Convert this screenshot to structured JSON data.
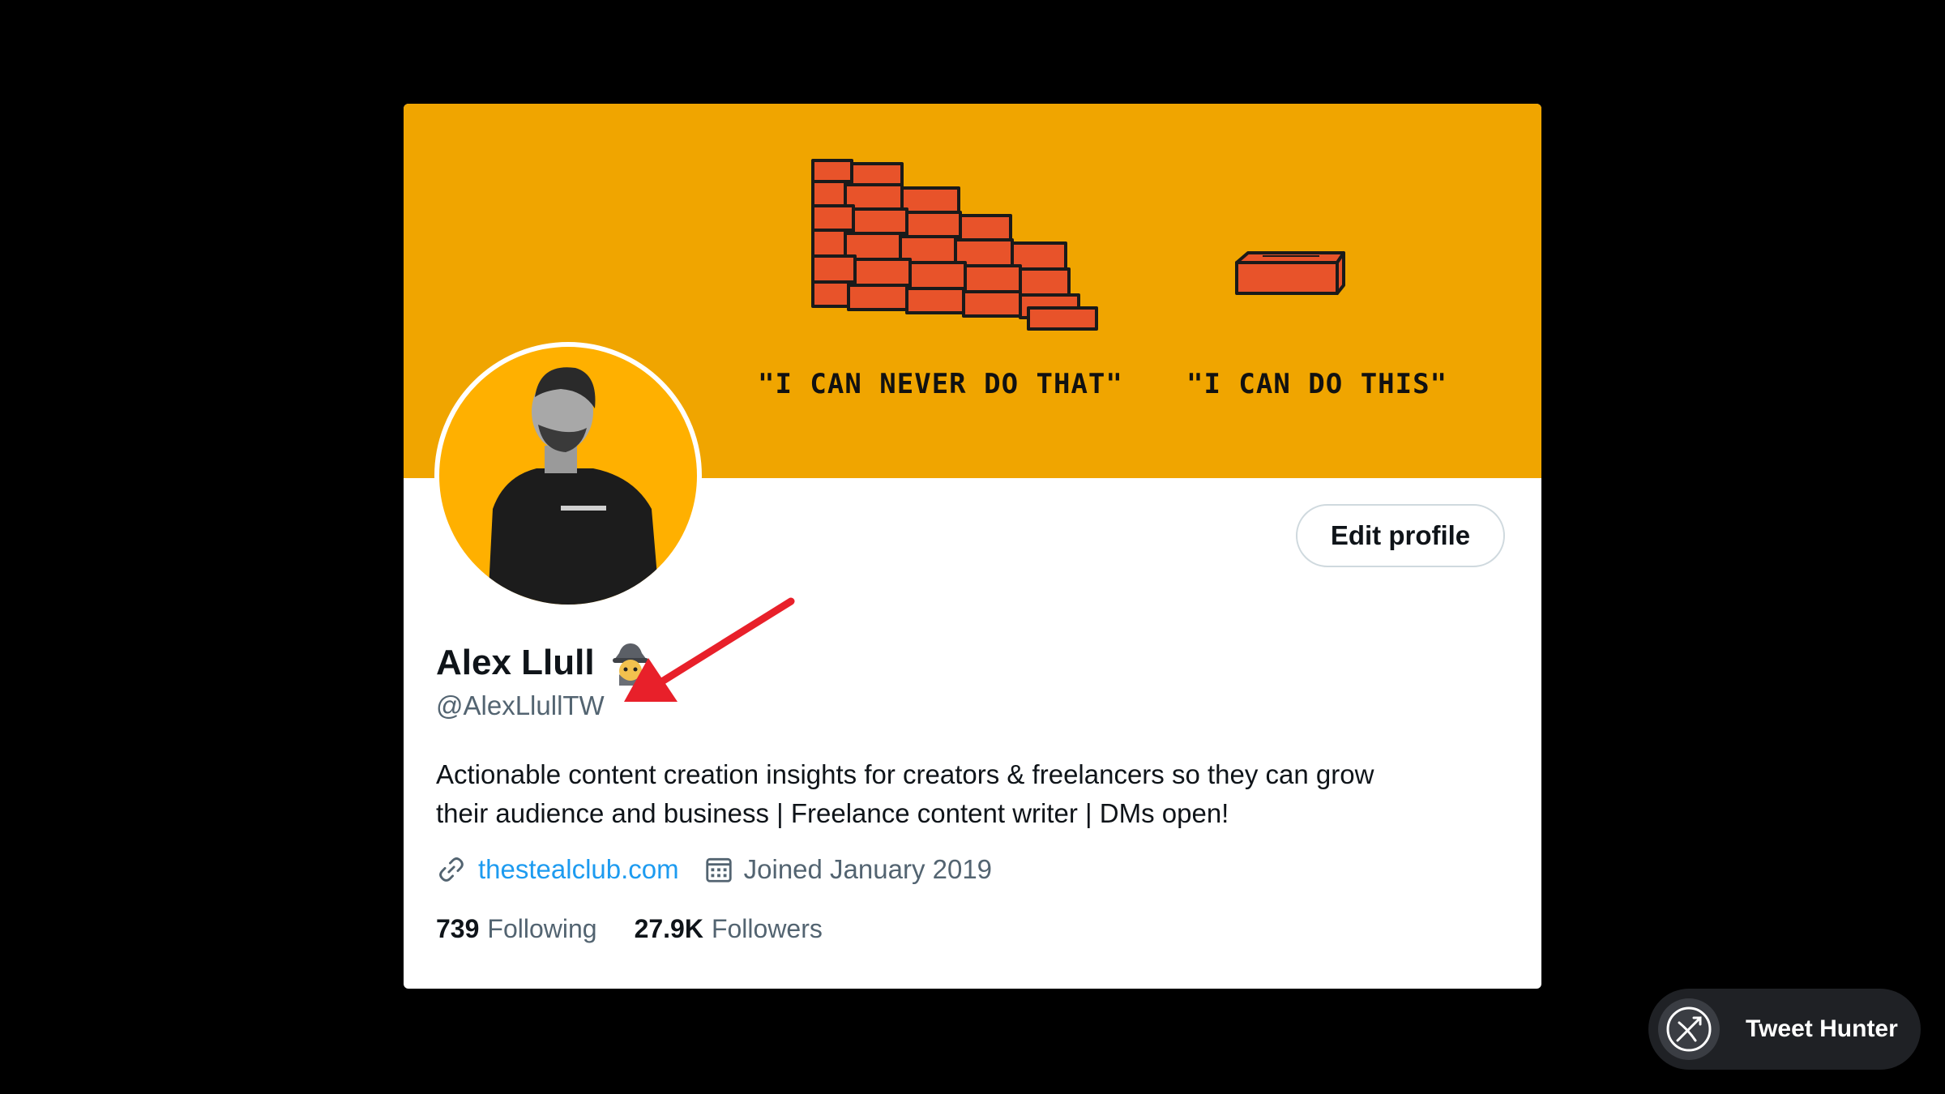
{
  "banner": {
    "background_color": "#F0A500",
    "caption_left": "\"I CAN NEVER DO THAT\"",
    "caption_right": "\"I CAN DO THIS\"",
    "illustration": "brick-wall-and-single-brick"
  },
  "profile": {
    "avatar_icon": "profile-photo",
    "edit_button_label": "Edit profile",
    "display_name": "Alex Llull",
    "name_emoji_icon": "detective-emoji-icon",
    "handle": "@AlexLlullTW",
    "bio_line_1": "Actionable content creation insights for creators & freelancers so they can grow",
    "bio_line_2": "their audience and business | Freelance content writer | DMs open!",
    "website": "thestealclub.com",
    "joined": "Joined January 2019",
    "following_count": "739",
    "following_label": "Following",
    "followers_count": "27.9K",
    "followers_label": "Followers"
  },
  "annotation": {
    "arrow_color": "#E8202A"
  },
  "watermark": {
    "label": "Tweet Hunter",
    "icon": "crossed-bow-icon"
  },
  "colors": {
    "accent_link": "#1D9BF0",
    "text_primary": "#0F1419",
    "text_secondary": "#536471"
  }
}
